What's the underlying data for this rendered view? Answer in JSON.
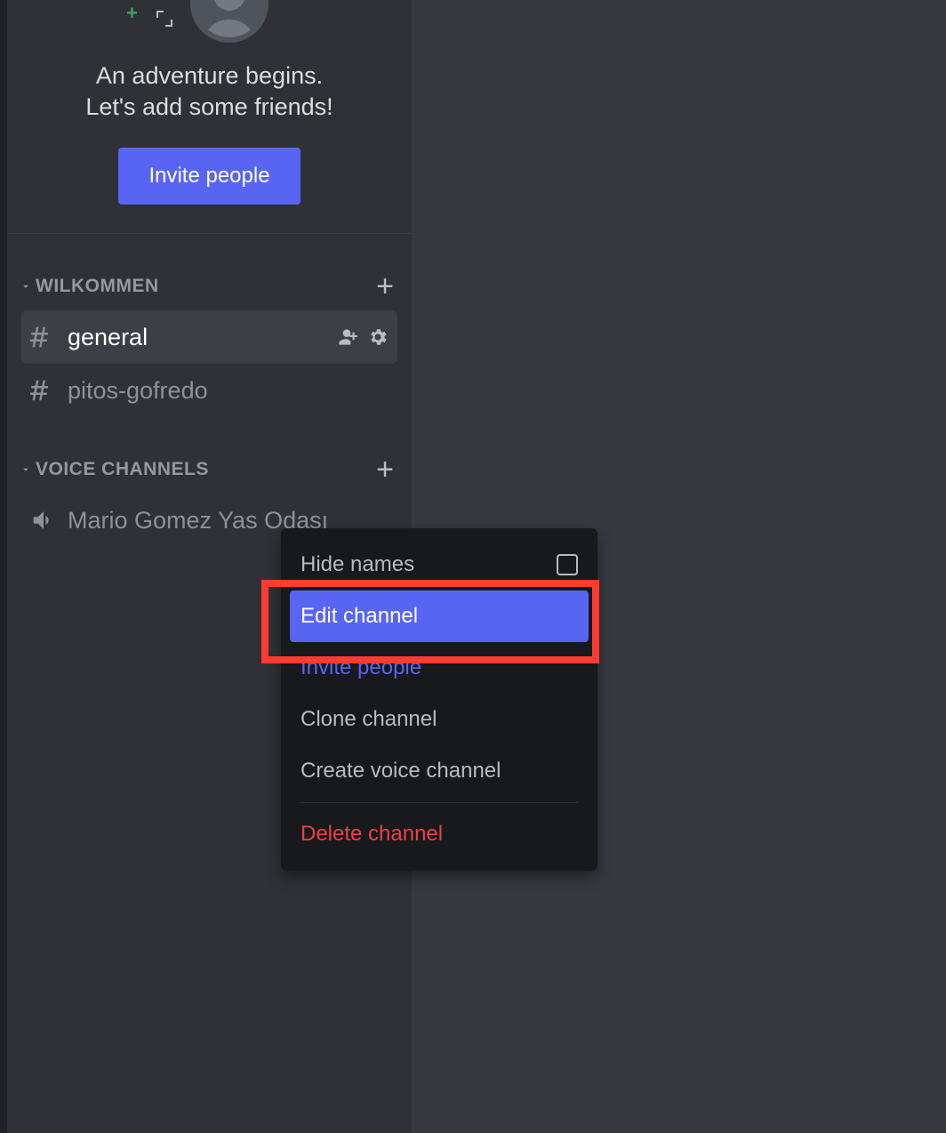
{
  "welcome": {
    "line1": "An adventure begins.",
    "line2": "Let's add some friends!",
    "invite_button": "Invite people"
  },
  "categories": [
    {
      "label": "WILKOMMEN",
      "channels": [
        {
          "type": "text",
          "name": "general",
          "selected": true,
          "show_actions": true
        },
        {
          "type": "text",
          "name": "pitos-gofredo",
          "selected": false,
          "show_actions": false
        }
      ]
    },
    {
      "label": "VOICE CHANNELS",
      "channels": [
        {
          "type": "voice",
          "name": "Mario Gomez Yas Odası",
          "selected": false,
          "show_actions": false
        }
      ]
    }
  ],
  "context_menu": {
    "hide_names": "Hide names",
    "edit_channel": "Edit channel",
    "invite_people": "Invite people",
    "clone_channel": "Clone channel",
    "create_voice_channel": "Create voice channel",
    "delete_channel": "Delete channel"
  },
  "colors": {
    "accent": "#5865f2",
    "danger": "#ed4245",
    "sidebar_bg": "#2f3136",
    "main_bg": "#36393f",
    "menu_bg": "#18191c"
  }
}
